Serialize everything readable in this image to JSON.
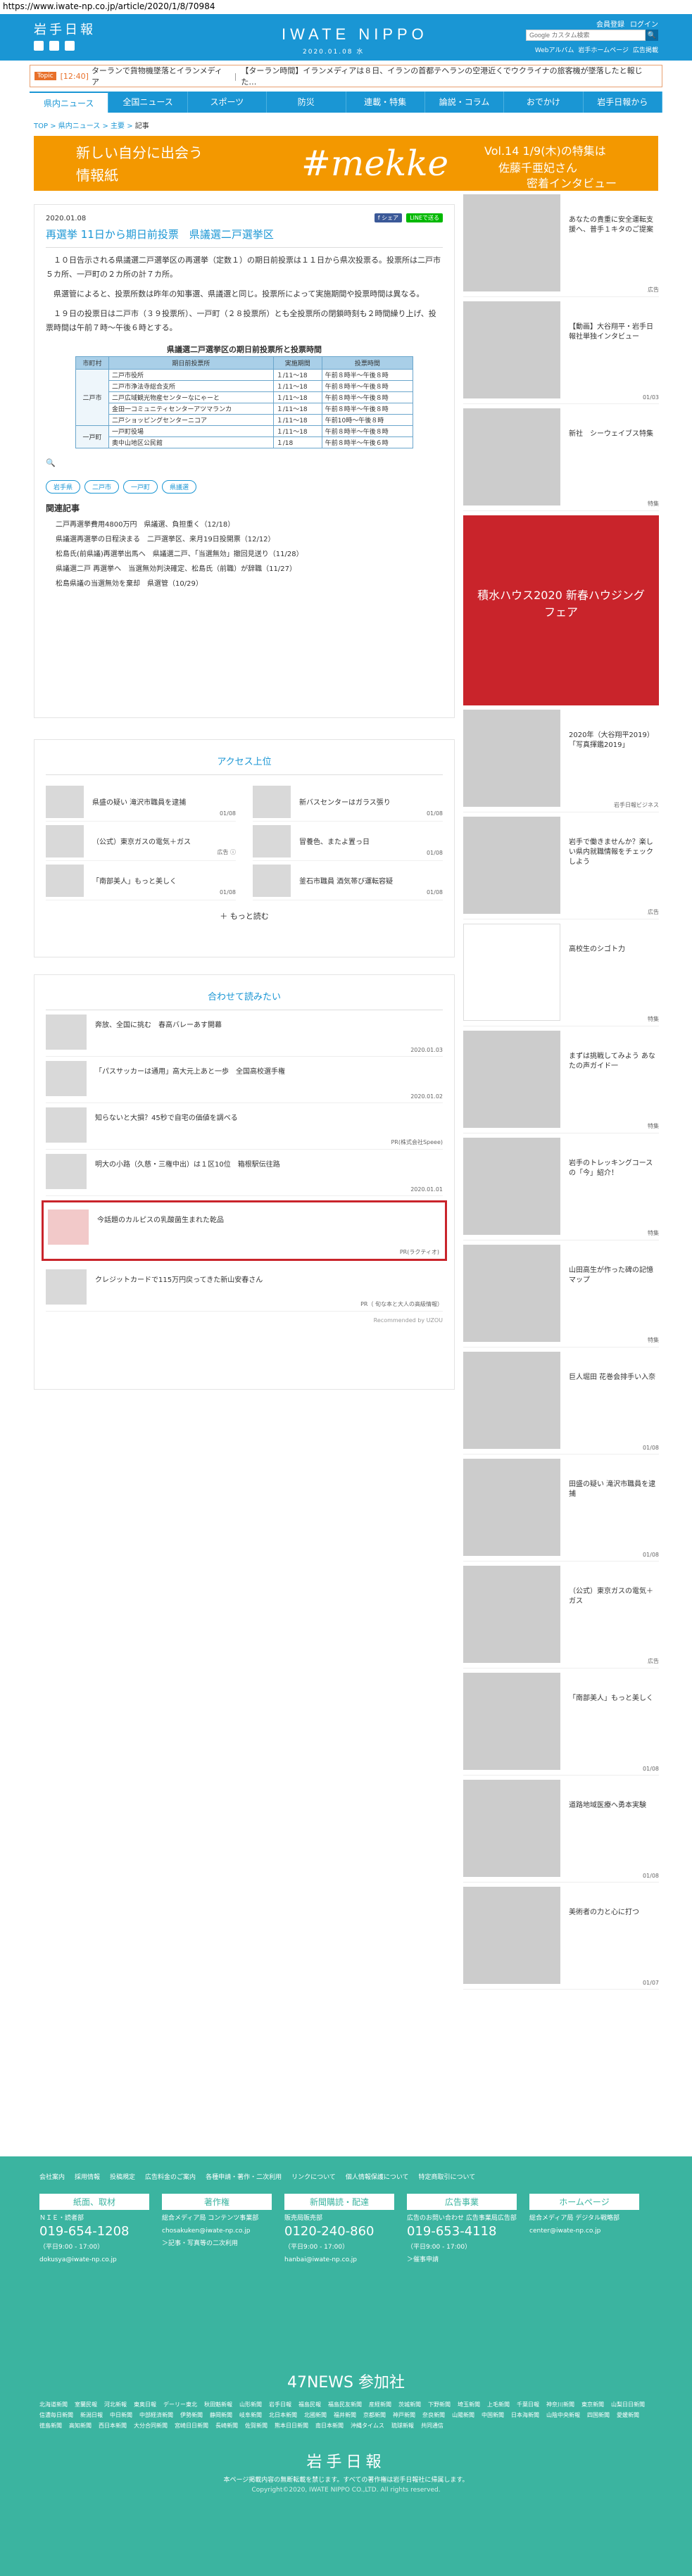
{
  "url": "https://www.iwate-np.co.jp/article/2020/1/8/70984",
  "header": {
    "logo_jp": "岩手日報",
    "logo_en": "IWATE NIPPO",
    "date": "2020.01.08 水",
    "toplinks": [
      "会員登録",
      "ログイン"
    ],
    "search_placeholder": "Google カスタム検索",
    "search_btn": "🔍",
    "sublinks": [
      "Webアルバム",
      "岩手ホームページ",
      "広告掲載"
    ]
  },
  "ticker": {
    "badge": "Topic",
    "time": "[12:40]",
    "items": [
      "ターランで貨物機墜落とイランメディア",
      "【ターラン時間】イランメディアは８日、イランの首都テヘランの空港近くでウクライナの旅客機が墜落したと報じた…"
    ]
  },
  "nav": [
    "県内ニュース",
    "全国ニュース",
    "スポーツ",
    "防災",
    "連載・特集",
    "論説・コラム",
    "おでかけ",
    "岩手日報から"
  ],
  "breadcrumb": {
    "top": "TOP",
    "sep1": " > ",
    "cat": "県内ニュース",
    "sep2": " > ",
    "sub": "主要",
    "sep3": " > ",
    "cur": "記事"
  },
  "banner": {
    "l1": "新しい自分に出会う",
    "l2": "情報紙",
    "brand": "#mekke",
    "r1": "Vol.14 1/9(木)の特集は",
    "r2": "佐藤千亜妃さん",
    "r3": "密着インタビュー"
  },
  "article": {
    "date": "2020.01.08",
    "share": [
      "f シェア",
      "LINEで送る"
    ],
    "title": "再選挙 11日から期日前投票　県議選二戸選挙区",
    "paras": [
      "１０日告示される県議選二戸選挙区の再選挙（定数１）の期日前投票は１１日から県次投票る。投票所は二戸市５カ所、一戸町の２カ所の計７カ所。",
      "県選管によると、投票所数は昨年の知事選、県議選と同じ。投票所によって実施期間や投票時間は異なる。",
      "１９日の投票日は二戸市（３９投票所）、一戸町（２８投票所）とも全投票所の閉鎖時刻も２時間繰り上げ、投票時間は午前７時～午後６時とする。"
    ],
    "table_caption": "県議選二戸選挙区の期日前投票所と投票時間",
    "table_headers": [
      "市町村",
      "期日前投票所",
      "実施期間",
      "投票時間"
    ],
    "table_rows": [
      {
        "city": "二戸市",
        "place": "二戸市役所",
        "period": "１/11～18",
        "time": "午前８時半～午後８時"
      },
      {
        "city": "",
        "place": "二戸市浄法寺総合支所",
        "period": "１/11～18",
        "time": "午前８時半～午後８時"
      },
      {
        "city": "",
        "place": "二戸広域観光物産センターなにゃーと",
        "period": "１/11～18",
        "time": "午前８時半～午後８時"
      },
      {
        "city": "",
        "place": "金田一コミュニティセンターアツマランカ",
        "period": "１/11～18",
        "time": "午前８時半～午後８時"
      },
      {
        "city": "",
        "place": "二戸ショッピングセンターニコア",
        "period": "１/11～18",
        "time": "午前10時～午後８時"
      },
      {
        "city": "一戸町",
        "place": "一戸町役場",
        "period": "１/11～18",
        "time": "午前８時半～午後８時"
      },
      {
        "city": "",
        "place": "奥中山地区公民館",
        "period": "１/18",
        "time": "午前８時半～午後６時"
      }
    ],
    "tags": [
      "岩手県",
      "二戸市",
      "一戸町",
      "県議選"
    ],
    "related_title": "関連記事",
    "related": [
      "二戸再選挙費用4800万円　県議選、負担重く（12/18）",
      "県議選再選挙の日程決まる　二戸選挙区、来月19日投開票（12/12）",
      "松島氏(前県議)再選挙出馬へ　県議選二戸、「当選無効」撤回見送り（11/28）",
      "県議選二戸 再選挙へ　当選無効判決確定、松島氏（前職）が辞職（11/27）",
      "松島県議の当選無効を棄却　県選管（10/29）"
    ]
  },
  "access": {
    "title": "アクセス上位",
    "items": [
      {
        "t": "県盛の疑い 滝沢市職員を逮捕",
        "d": "01/08"
      },
      {
        "t": "新バスセンターはガラス張り",
        "d": "01/08"
      },
      {
        "t": "（公式）東京ガスの電気＋ガス",
        "d": "広告 ⓘ"
      },
      {
        "t": "冒養色、またよ置っ日",
        "d": "01/08"
      },
      {
        "t": "「南部美人」もっと美しく",
        "d": "01/08"
      },
      {
        "t": "釜石市職員 酒気帯び運転容疑",
        "d": "01/08"
      }
    ],
    "more": "＋ もっと読む"
  },
  "recommend": {
    "title": "合わせて読みたい",
    "items": [
      {
        "t": "奔放、全国に挑む　春高バレーあす開幕",
        "d": "2020.01.03"
      },
      {
        "t": "「パスサッカーは通用」高大元上あと一歩　全国高校選手権",
        "d": "2020.01.02"
      },
      {
        "t": "知らないと大損？45秒で自宅の価値を調べる",
        "d": "PR(株式会社Speee)"
      },
      {
        "t": "明大の小路（久慈・三権中出）は１区10位　箱根駅伝往路",
        "d": "2020.01.01"
      },
      {
        "t": "今話題のカルピスの乳酸菌生まれた乾品",
        "d": "PR(ラクティオ)"
      },
      {
        "t": "クレジットカードで115万円戻ってきた新山安春さん",
        "d": "PR（ 旬な本と大人の高級情報）"
      }
    ],
    "powered": "Recommended by UZOU"
  },
  "sidebar": {
    "top_label": "広告",
    "items": [
      {
        "t": "あなたの貴重に安全運転支援へ、普手１キタのご提案",
        "d": "広告"
      },
      {
        "t": "【動画】大谷翔平・岩手日報社単独インタビュー",
        "d": "01/03"
      },
      {
        "t": "新社　シーウェイブス特集",
        "d": "特集"
      },
      {
        "t": "積水ハウス2020 新春ハウジングフェア",
        "d": ""
      },
      {
        "t": "2020年（大谷翔平2019）「写真揮鑑2019」",
        "d": "岩手日報ビジネス"
      },
      {
        "t": "岩手で働きませんか？楽しい県内就職情報をチェックしよう",
        "d": "広告"
      },
      {
        "t": "高校生のシゴト力",
        "d": "特集"
      },
      {
        "t": "まずは挑戦してみよう あなたの声ガイド一",
        "d": "特集"
      },
      {
        "t": "岩手のトレッキングコースの「今」紹介！",
        "d": "特集"
      },
      {
        "t": "山田高生が作った碑の記憶マップ",
        "d": "特集"
      },
      {
        "t": "巨人堀田 花巻会排手い入奈",
        "d": "01/08"
      },
      {
        "t": "田盛の疑い 滝沢市職員を逮捕",
        "d": "01/08"
      },
      {
        "t": "（公式）東京ガスの電気＋ガス",
        "d": "広告"
      },
      {
        "t": "「南部美人」もっと美しく",
        "d": "01/08"
      },
      {
        "t": "道路地域医療へ勇本実験",
        "d": "01/08"
      },
      {
        "t": "美術者の力と心に打つ",
        "d": "01/07"
      }
    ]
  },
  "footer": {
    "links": [
      "会社案内",
      "採用情報",
      "投稿規定",
      "広告料金のご案内",
      "各種申請・著作・二次利用",
      "リンクについて",
      "個人情報保護について",
      "特定商取引について"
    ],
    "cols": [
      {
        "h": "紙面、取材",
        "x1": "ＮＩＥ・読者部",
        "phone": "019-654-1208",
        "x2": "（平日9:00 - 17:00）",
        "mail": "dokusya@iwate-np.co.jp"
      },
      {
        "h": "著作権",
        "x1": "総合メディア局 コンテンツ事業部",
        "phone": "",
        "x2": "chosakuken@iwate-np.co.jp",
        "mail": "＞記事・写真等の二次利用"
      },
      {
        "h": "新聞購読・配達",
        "x1": "販売局販売部",
        "phone": "0120-240-860",
        "x2": "（平日9:00 - 17:00）",
        "mail": "hanbai@iwate-np.co.jp"
      },
      {
        "h": "広告事業",
        "x1": "広告のお問い合わせ 広告事業局広告部",
        "phone": "019-653-4118",
        "x2": "（平日9:00 - 17:00）",
        "mail": "＞催事申請"
      },
      {
        "h": "ホームページ",
        "x1": "総合メディア局 デジタル戦略部",
        "phone": "",
        "x2": "center@iwate-np.co.jp",
        "mail": ""
      }
    ],
    "news47": "47NEWS 参加社",
    "members": [
      "北海道新聞",
      "室蘭民報",
      "河北新報",
      "東奥日報",
      "デーリー東北",
      "秋田魁新報",
      "山形新聞",
      "岩手日報",
      "福島民報",
      "福島民友新聞",
      "産経新聞",
      "茨城新聞",
      "下野新聞",
      "埼玉新聞",
      "上毛新聞",
      "千葉日報",
      "神奈川新聞",
      "東京新聞",
      "山梨日日新聞",
      "信濃毎日新聞",
      "新潟日報",
      "中日新聞",
      "中部経済新聞",
      "伊勢新聞",
      "静岡新聞",
      "岐阜新聞",
      "北日本新聞",
      "北國新聞",
      "福井新聞",
      "京都新聞",
      "神戸新聞",
      "奈良新聞",
      "山陽新聞",
      "中国新聞",
      "日本海新聞",
      "山陰中央新報",
      "四国新聞",
      "愛媛新聞",
      "徳島新聞",
      "高知新聞",
      "西日本新聞",
      "大分合同新聞",
      "宮崎日日新聞",
      "長崎新聞",
      "佐賀新聞",
      "熊本日日新聞",
      "南日本新聞",
      "沖縄タイムス",
      "琉球新報",
      "共同通信"
    ],
    "logo": "岩手日報",
    "note": "本ページ掲載内容の無断転載を禁じます。すべての著作権は岩手日報社に帰属します。",
    "copy": "Copyright©2020, IWATE NIPPO CO.,LTD. All rights reserved."
  },
  "colors": {
    "brand": "#1a96d4",
    "footer": "#3bb4a0",
    "ad_frame": "#c9242b",
    "banner": "#f39800"
  }
}
